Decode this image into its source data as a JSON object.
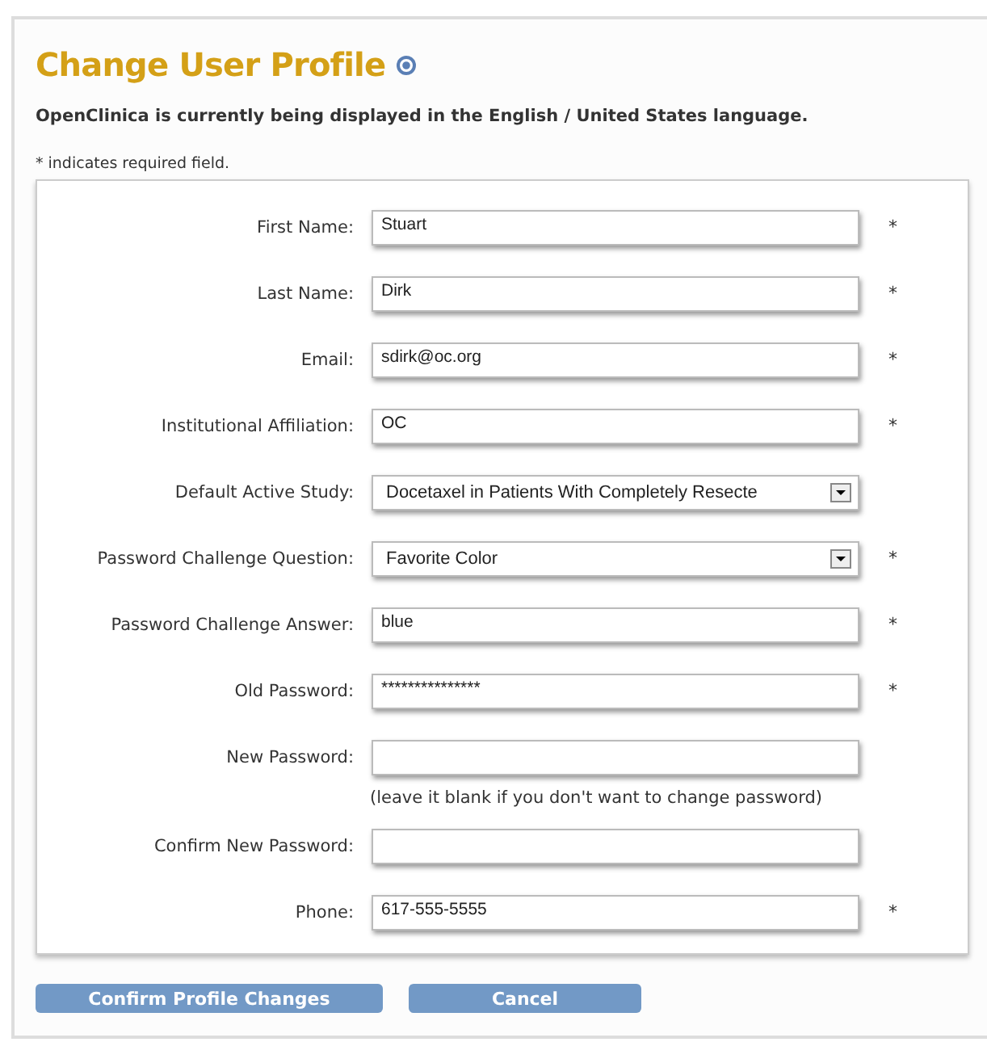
{
  "title": "Change User Profile",
  "language_note": "OpenClinica is currently being displayed in the English / United States  language.",
  "required_note": "* indicates required field.",
  "fields": [
    {
      "kind": "text",
      "label": "First Name:",
      "value": "Stuart",
      "required_mark": "*"
    },
    {
      "kind": "text",
      "label": "Last Name:",
      "value": "Dirk",
      "required_mark": "*"
    },
    {
      "kind": "text",
      "label": "Email:",
      "value": "sdirk@oc.org",
      "required_mark": "*"
    },
    {
      "kind": "text",
      "label": "Institutional Affiliation:",
      "value": "OC",
      "required_mark": "*"
    },
    {
      "kind": "select",
      "label": "Default Active Study:",
      "value": "Docetaxel in Patients With Completely Resecte"
    },
    {
      "kind": "select",
      "label": "Password Challenge Question:",
      "value": "Favorite Color",
      "required_mark": "*"
    },
    {
      "kind": "text",
      "label": "Password Challenge Answer:",
      "value": "blue",
      "required_mark": "*"
    },
    {
      "kind": "text",
      "label": "Old Password:",
      "value": "***************",
      "required_mark": "*"
    },
    {
      "kind": "text",
      "label": "New Password:"
    },
    {
      "kind": "hint",
      "text": "(leave it blank if you don't want to change password)"
    },
    {
      "kind": "text",
      "label": "Confirm New Password:"
    },
    {
      "kind": "text",
      "label": "Phone:",
      "value": "617-555-5555",
      "required_mark": "*"
    }
  ],
  "buttons": [
    "Confirm Profile Changes",
    "Cancel"
  ]
}
